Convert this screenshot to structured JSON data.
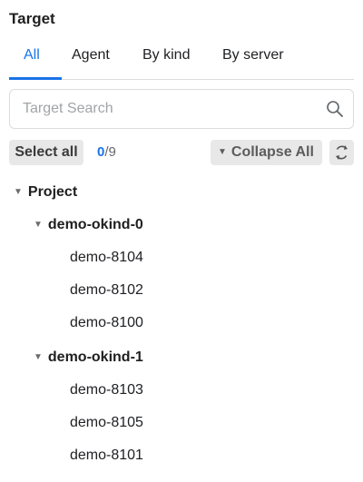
{
  "panel": {
    "title": "Target"
  },
  "tabs": [
    {
      "label": "All",
      "active": true
    },
    {
      "label": "Agent",
      "active": false
    },
    {
      "label": "By kind",
      "active": false
    },
    {
      "label": "By server",
      "active": false
    }
  ],
  "search": {
    "placeholder": "Target Search",
    "value": ""
  },
  "toolbar": {
    "select_all_label": "Select all",
    "selected_count": "0",
    "total_count": "/9",
    "collapse_all_label": "Collapse All"
  },
  "tree": {
    "root": {
      "label": "Project",
      "expanded": true
    },
    "groups": [
      {
        "label": "demo-okind-0",
        "expanded": true,
        "items": [
          "demo-8104",
          "demo-8102",
          "demo-8100"
        ]
      },
      {
        "label": "demo-okind-1",
        "expanded": true,
        "items": [
          "demo-8103",
          "demo-8105",
          "demo-8101"
        ]
      }
    ]
  },
  "colors": {
    "accent": "#1a73e8",
    "button_bg": "#e8e8e8",
    "border": "#dadce0"
  },
  "icons": {
    "search": "search-icon",
    "refresh": "refresh-icon",
    "caret": "caret-down-icon"
  }
}
